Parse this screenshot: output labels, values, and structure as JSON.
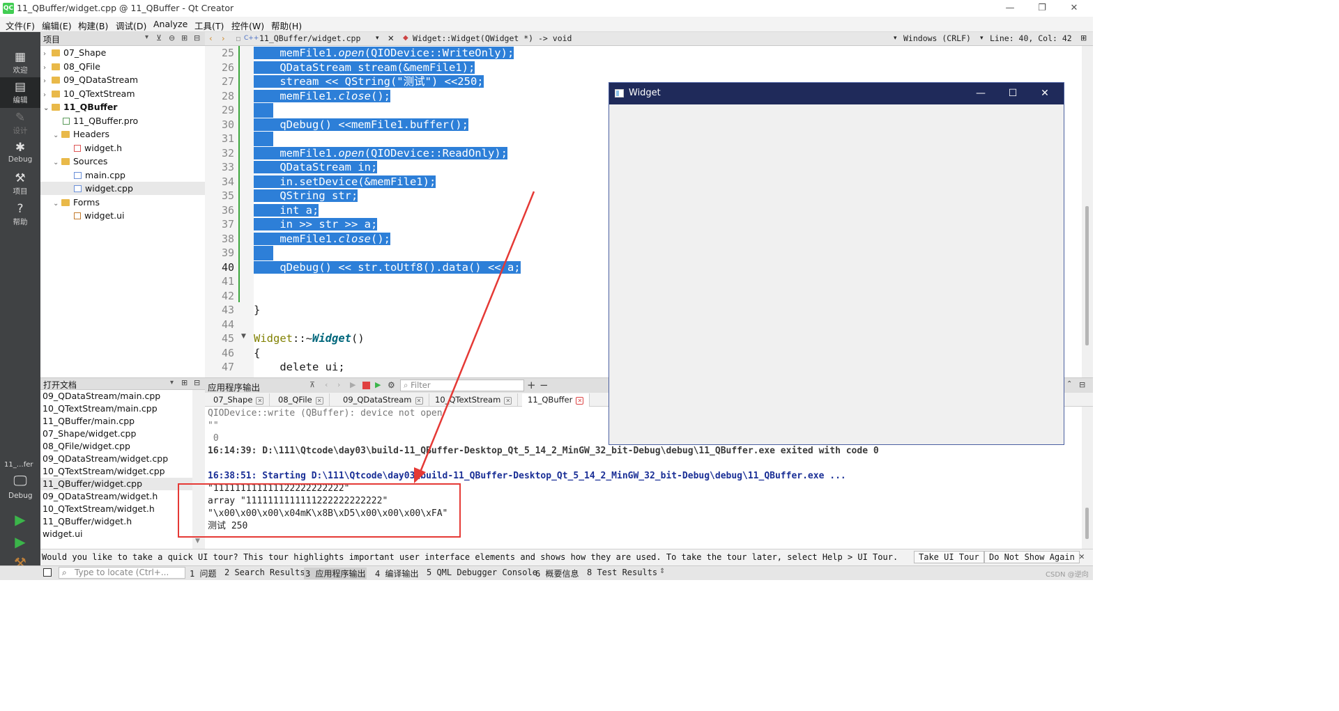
{
  "window": {
    "title": "11_QBuffer/widget.cpp @ 11_QBuffer - Qt Creator",
    "app_icon": "QC",
    "controls": [
      "—",
      "❐",
      "✕"
    ]
  },
  "menu": [
    "文件(F)",
    "编辑(E)",
    "构建(B)",
    "调试(D)",
    "Analyze",
    "工具(T)",
    "控件(W)",
    "帮助(H)"
  ],
  "modes": {
    "welcome": "欢迎",
    "edit": "编辑",
    "design": "设计",
    "debug": "Debug",
    "projects": "项目",
    "help": "帮助",
    "kit_name": "11_…fer",
    "kit_mode": "Debug"
  },
  "projects_panel": {
    "title": "项目",
    "items": [
      {
        "label": "07_Shape"
      },
      {
        "label": "08_QFile"
      },
      {
        "label": "09_QDataStream"
      },
      {
        "label": "10_QTextStream"
      },
      {
        "label": "11_QBuffer"
      },
      {
        "label": "11_QBuffer.pro"
      },
      {
        "label": "Headers"
      },
      {
        "label": "widget.h"
      },
      {
        "label": "Sources"
      },
      {
        "label": "main.cpp"
      },
      {
        "label": "widget.cpp"
      },
      {
        "label": "Forms"
      },
      {
        "label": "widget.ui"
      }
    ]
  },
  "open_documents": {
    "title": "打开文档",
    "items": [
      "09_QDataStream/main.cpp",
      "10_QTextStream/main.cpp",
      "11_QBuffer/main.cpp",
      "07_Shape/widget.cpp",
      "08_QFile/widget.cpp",
      "09_QDataStream/widget.cpp",
      "10_QTextStream/widget.cpp",
      "11_QBuffer/widget.cpp",
      "09_QDataStream/widget.h",
      "10_QTextStream/widget.h",
      "11_QBuffer/widget.h",
      "widget.ui"
    ]
  },
  "editor_toolbar": {
    "file": "11_QBuffer/widget.cpp",
    "symbol": "Widget::Widget(QWidget *) -> void",
    "line_ending": "Windows (CRLF)",
    "position": "Line: 40, Col: 42"
  },
  "code_lines": [
    {
      "n": "25",
      "indent": "    ",
      "parts": [
        {
          "t": "memFile1."
        },
        {
          "t": "open",
          "c": "it"
        },
        {
          "t": "(QIODevice::WriteOnly);"
        }
      ]
    },
    {
      "n": "26",
      "indent": "    ",
      "parts": [
        {
          "t": "QDataStream stream(&memFile1);"
        }
      ]
    },
    {
      "n": "27",
      "indent": "    ",
      "parts": [
        {
          "t": "stream << QString(\"测试\") <<250;"
        }
      ]
    },
    {
      "n": "28",
      "indent": "    ",
      "parts": [
        {
          "t": "memFile1."
        },
        {
          "t": "close",
          "c": "it"
        },
        {
          "t": "();"
        }
      ]
    },
    {
      "n": "29",
      "indent": "",
      "parts": []
    },
    {
      "n": "30",
      "indent": "    ",
      "parts": [
        {
          "t": "qDebug() <<memFile1.buffer();"
        }
      ]
    },
    {
      "n": "31",
      "indent": "",
      "parts": []
    },
    {
      "n": "32",
      "indent": "    ",
      "parts": [
        {
          "t": "memFile1."
        },
        {
          "t": "open",
          "c": "it"
        },
        {
          "t": "(QIODevice::ReadOnly);"
        }
      ]
    },
    {
      "n": "33",
      "indent": "    ",
      "parts": [
        {
          "t": "QDataStream in;"
        }
      ]
    },
    {
      "n": "34",
      "indent": "    ",
      "parts": [
        {
          "t": "in.setDevice(&memFile1);"
        }
      ]
    },
    {
      "n": "35",
      "indent": "    ",
      "parts": [
        {
          "t": "QString str;"
        }
      ]
    },
    {
      "n": "36",
      "indent": "    ",
      "parts": [
        {
          "t": "int a;"
        }
      ]
    },
    {
      "n": "37",
      "indent": "    ",
      "parts": [
        {
          "t": "in >> str >> a;"
        }
      ]
    },
    {
      "n": "38",
      "indent": "    ",
      "parts": [
        {
          "t": "memFile1."
        },
        {
          "t": "close",
          "c": "it"
        },
        {
          "t": "();"
        }
      ]
    },
    {
      "n": "39",
      "indent": "",
      "parts": []
    },
    {
      "n": "40",
      "indent": "    ",
      "parts": [
        {
          "t": "qDebug() << str.toUtf8().data() << a;"
        }
      ]
    },
    {
      "n": "41",
      "indent": "",
      "parts": []
    },
    {
      "n": "42",
      "indent": "",
      "parts": []
    },
    {
      "n": "43",
      "indent": "",
      "parts": [
        {
          "t": "}"
        }
      ]
    },
    {
      "n": "44",
      "indent": "",
      "parts": []
    },
    {
      "n": "45",
      "indent": "",
      "parts": [
        {
          "t": "Widget",
          "c": "kw"
        },
        {
          "t": "::~"
        },
        {
          "t": "Widget",
          "c": "fnb"
        },
        {
          "t": "()"
        }
      ]
    },
    {
      "n": "46",
      "indent": "",
      "parts": [
        {
          "t": "{"
        }
      ]
    },
    {
      "n": "47",
      "indent": "    ",
      "parts": [
        {
          "t": "delete ui;"
        }
      ]
    }
  ],
  "output_pane": {
    "title": "应用程序输出",
    "filter_placeholder": "Filter",
    "tabs": [
      "07_Shape",
      "08_QFile",
      "09_QDataStream",
      "10_QTextStream",
      "11_QBuffer"
    ],
    "lines": [
      {
        "t": "QIODevice::write (QBuffer): device not open",
        "s": "grey"
      },
      {
        "t": "\"\"",
        "s": "grey"
      },
      {
        "t": " 0",
        "s": "grey"
      },
      {
        "t": "16:14:39: D:\\111\\Qtcode\\day03\\build-11_QBuffer-Desktop_Qt_5_14_2_MinGW_32_bit-Debug\\debug\\11_QBuffer.exe exited with code 0",
        "s": "bold"
      },
      {
        "t": "",
        "s": ""
      },
      {
        "t": "16:38:51: Starting D:\\111\\Qtcode\\day03\\build-11_QBuffer-Desktop_Qt_5_14_2_MinGW_32_bit-Debug\\debug\\11_QBuffer.exe ...",
        "s": "blue"
      },
      {
        "t": "\"111111111111122222222222\"",
        "s": ""
      },
      {
        "t": "array \"1111111111111222222222222\"",
        "s": ""
      },
      {
        "t": "\"\\x00\\x00\\x00\\x04mK\\x8B\\xD5\\x00\\x00\\x00\\xFA\"",
        "s": ""
      },
      {
        "t": "测试 250",
        "s": ""
      }
    ]
  },
  "info_bar": {
    "message": "Would you like to take a quick UI tour? This tour highlights important user interface elements and shows how they are used. To take the tour later, select Help > UI Tour.",
    "take_tour": "Take UI Tour",
    "dont_show": "Do Not Show Again"
  },
  "status_bar": {
    "locate_placeholder": "Type to locate (Ctrl+...",
    "panes": [
      "1 问题",
      "2 Search Results",
      "3 应用程序输出",
      "4 编译输出",
      "5 QML Debugger Console",
      "6 概要信息",
      "8 Test Results"
    ]
  },
  "widget_window": {
    "title": "Widget"
  },
  "watermark": "CSDN @逆向",
  "colors": {
    "selection": "#2d7fd8",
    "annotation": "#e53935",
    "modebar": "#404244",
    "widget_titlebar": "#1f2a5a"
  }
}
